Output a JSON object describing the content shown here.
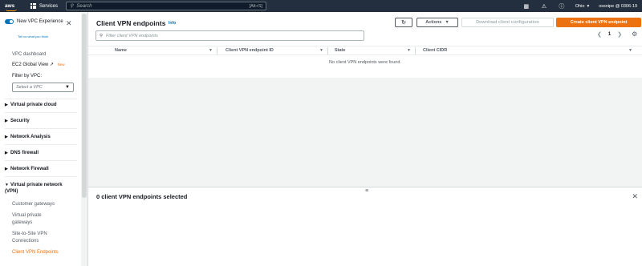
{
  "topnav": {
    "logo": "aws",
    "services_label": "Services",
    "search_placeholder": "Search",
    "search_shortcut": "[Alt+S]",
    "region": "Ohio",
    "account": "ossnipe @ 0306-19"
  },
  "sidebar": {
    "new_vpc_label": "New VPC Experience",
    "tell_us": "Tell us what you think",
    "vpc_dashboard": "VPC dashboard",
    "ec2_global_view": "EC2 Global View",
    "new_badge": "New",
    "filter_by_vpc": "Filter by VPC:",
    "select_vpc_placeholder": "Select a VPC",
    "sections": [
      "Virtual private cloud",
      "Security",
      "Network Analysis",
      "DNS firewall",
      "Network Firewall",
      "Virtual private network (VPN)"
    ],
    "vpn_items": [
      "Customer gateways",
      "Virtual private gateways",
      "Site-to-Site VPN Connections",
      "Client VPN Endpoints"
    ]
  },
  "main": {
    "title": "Client VPN endpoints",
    "info": "Info",
    "actions_label": "Actions",
    "download_label": "Download client configuration",
    "create_label": "Create client VPN endpoint",
    "filter_placeholder": "Filter client VPN endpoints",
    "page_number": "1",
    "columns": [
      "Name",
      "Client VPN endpoint ID",
      "State",
      "Client CIDR"
    ],
    "empty_message": "No client VPN endpoints were found.",
    "selection_title": "0 client VPN endpoints selected"
  },
  "colors": {
    "nav_bg": "#232f3e",
    "accent_orange": "#ec7211",
    "link_blue": "#0073bb"
  }
}
